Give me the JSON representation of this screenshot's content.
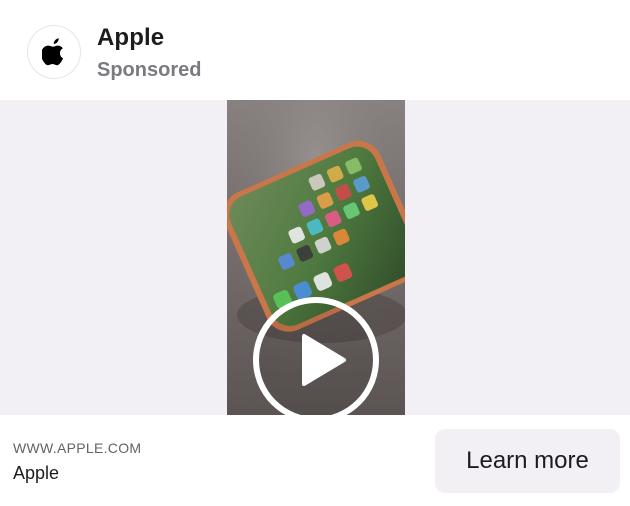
{
  "advertiser": {
    "name": "Apple",
    "sponsored_label": "Sponsored",
    "logo_icon": "apple-logo-icon"
  },
  "media": {
    "type": "video",
    "play_icon": "play-icon",
    "placeholder_bg": "#f2f0f4"
  },
  "footer": {
    "domain": "WWW.APPLE.COM",
    "headline": "Apple",
    "cta_label": "Learn more"
  }
}
